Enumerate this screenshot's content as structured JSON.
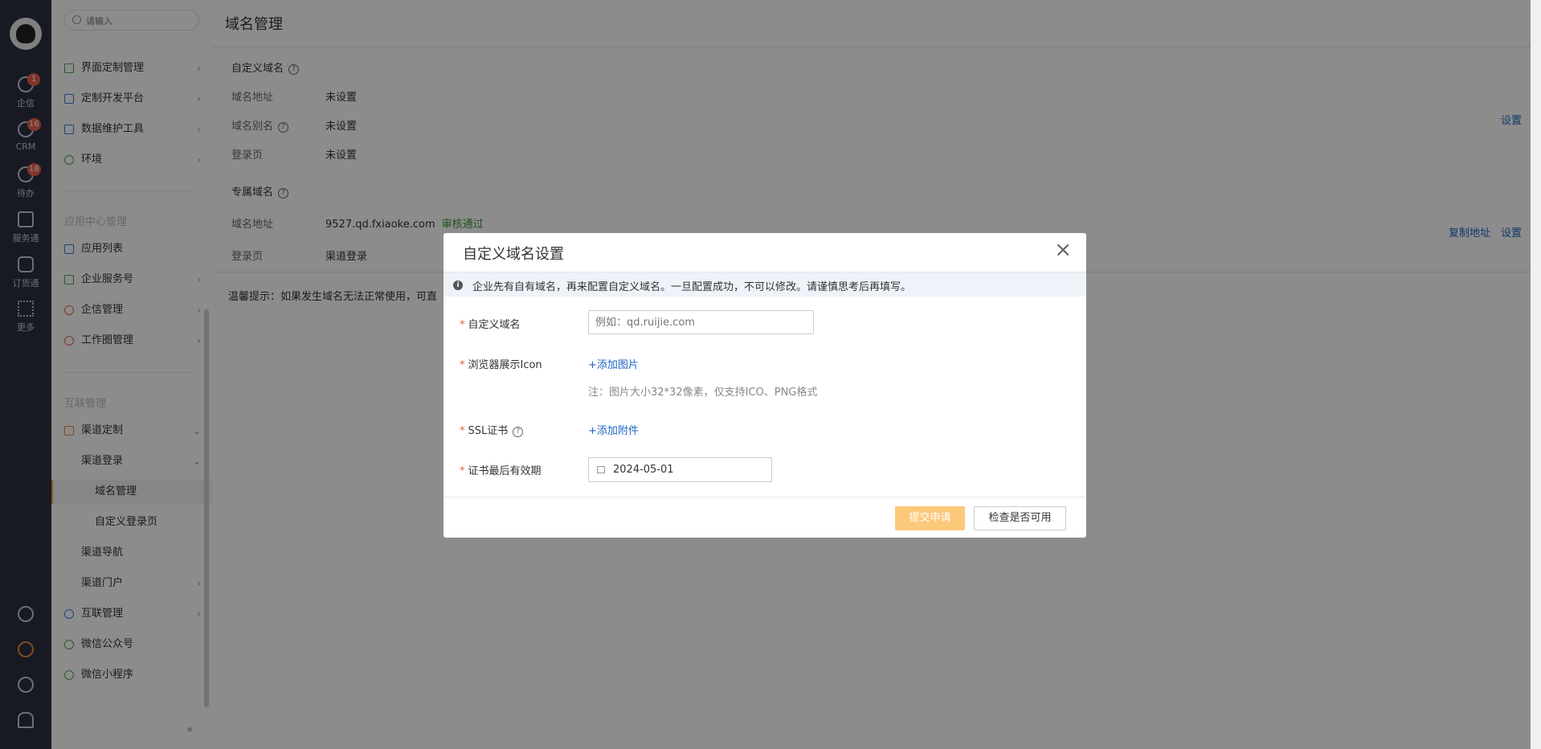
{
  "rail": {
    "items": [
      {
        "label": "企信",
        "badge": "1",
        "icon": "chat-icon"
      },
      {
        "label": "CRM",
        "badge": "16",
        "icon": "clock-icon"
      },
      {
        "label": "待办",
        "badge": "18",
        "icon": "check-circle-icon"
      },
      {
        "label": "服务通",
        "icon": "service-icon"
      },
      {
        "label": "订货通",
        "icon": "order-icon"
      },
      {
        "label": "更多",
        "icon": "grid-icon"
      }
    ],
    "bottom_icons": [
      "help-icon",
      "settings-icon",
      "history-icon",
      "user-settings-icon"
    ]
  },
  "menu": {
    "search_placeholder": "请输入",
    "items_top": [
      {
        "label": "界面定制管理",
        "icon": "layout-icon"
      },
      {
        "label": "定制开发平台",
        "icon": "chart-icon"
      },
      {
        "label": "数据维护工具",
        "icon": "bar-chart-icon"
      },
      {
        "label": "环境",
        "icon": "environment-icon"
      }
    ],
    "section_app": "应用中心管理",
    "items_app": [
      {
        "label": "应用列表",
        "icon": "apps-icon"
      },
      {
        "label": "企业服务号",
        "icon": "service-account-icon"
      },
      {
        "label": "企信管理",
        "icon": "message-icon"
      },
      {
        "label": "工作圈管理",
        "icon": "circle-icon"
      }
    ],
    "section_link": "互联管理",
    "items_link": {
      "channel_custom": "渠道定制",
      "channel_login": "渠道登录",
      "domain_mgmt": "域名管理",
      "custom_login": "自定义登录页",
      "channel_nav": "渠道导航",
      "channel_portal": "渠道门户",
      "interconnect": "互联管理",
      "wechat_official": "微信公众号",
      "wechat_mini": "微信小程序"
    },
    "collapse": "«"
  },
  "content": {
    "title": "域名管理",
    "custom_domain": {
      "title": "自定义域名",
      "rows": [
        {
          "label": "域名地址",
          "value": "未设置"
        },
        {
          "label": "域名别名",
          "value": "未设置"
        },
        {
          "label": "登录页",
          "value": "未设置"
        }
      ],
      "set_link": "设置"
    },
    "dedicated_domain": {
      "title": "专属域名",
      "address_label": "域名地址",
      "address_value": "9527.qd.fxiaoke.com",
      "status": "审核通过",
      "login_label": "登录页",
      "login_value": "渠道登录",
      "copy_link": "复制地址",
      "set_link": "设置"
    },
    "tip": "温馨提示：如果发生域名无法正常使用，可直"
  },
  "modal": {
    "title": "自定义域名设置",
    "notice": "企业先有自有域名，再来配置自定义域名。一旦配置成功，不可以修改。请谨慎思考后再填写。",
    "fields": {
      "domain_label": "自定义域名",
      "domain_placeholder": "例如：qd.ruijie.com",
      "icon_label": "浏览器展示Icon",
      "icon_add": "+添加图片",
      "icon_note": "注：图片大小32*32像素，仅支持ICO、PNG格式",
      "ssl_label": "SSL证书",
      "ssl_add": "+添加附件",
      "expiry_label": "证书最后有效期",
      "expiry_value": "2024-05-01"
    },
    "submit": "提交申请",
    "check": "检查是否可用"
  }
}
